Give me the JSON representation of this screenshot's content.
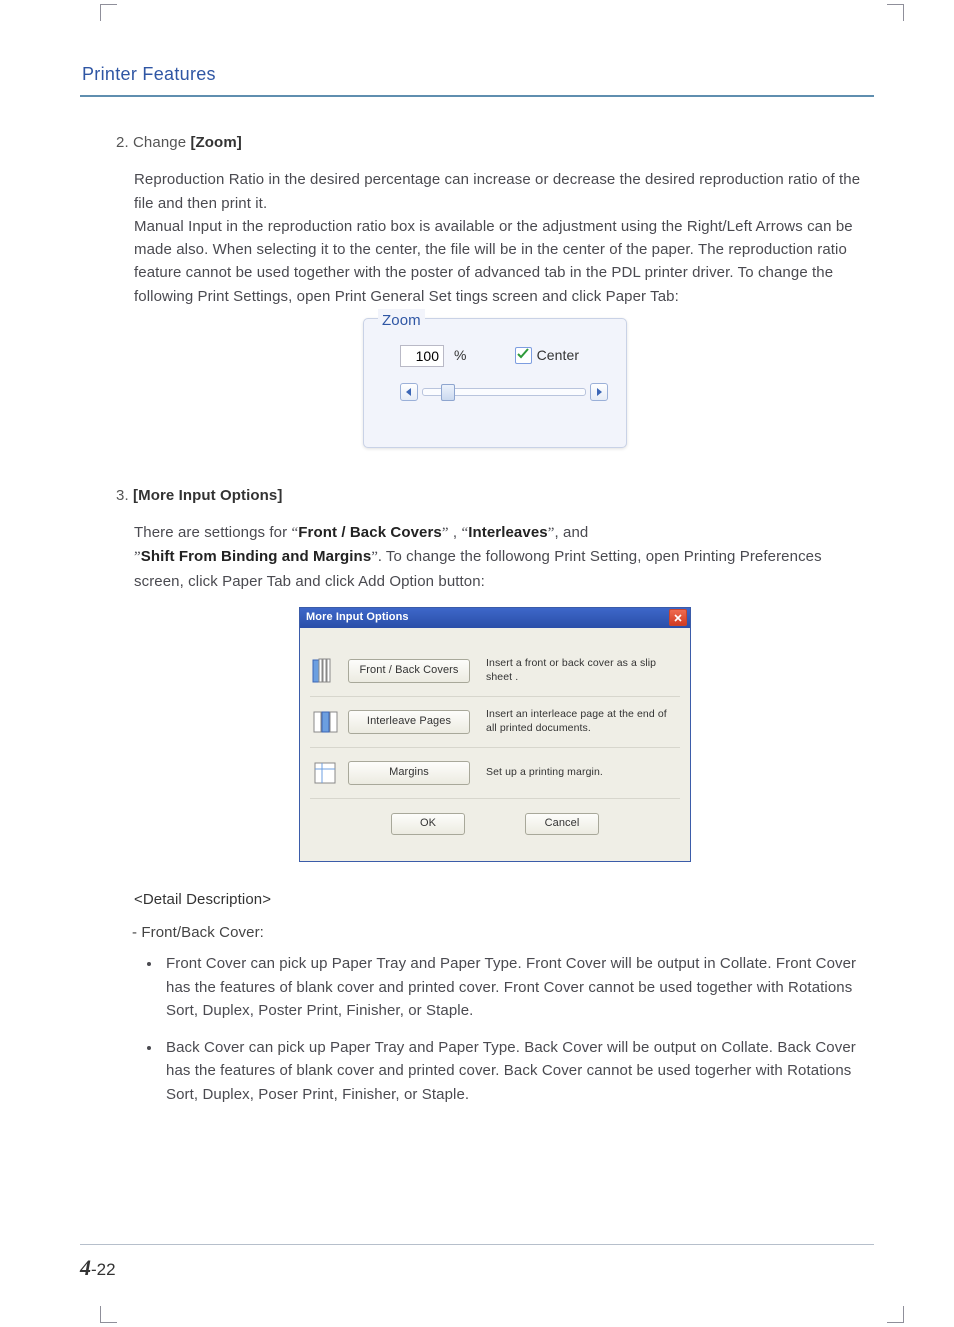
{
  "header": {
    "title": "Printer Features"
  },
  "step2": {
    "number": "2.",
    "prefix": "Change",
    "bold": "[Zoom]",
    "paragraph": "Reproduction Ratio in the desired percentage can increase or decrease the desired reproduction ratio of the file and then print it.\nManual  Input in the reproduction ratio box is available or the adjustment using the Right/Left Arrows can be made also. When selecting it to the center, the file will be in the center of the paper. The reproduction ratio feature cannot be used together with the poster of advanced tab in the PDL printer driver. To change the following Print Settings, open Print General Set tings screen and click Paper Tab:"
  },
  "zoom_widget": {
    "legend": "Zoom",
    "value": "100",
    "percent": "%",
    "checkbox_label": "Center"
  },
  "step3": {
    "number": "3.",
    "bold": "[More Input Options]",
    "line1_pre": "There are settiongs for ",
    "q1": "Front / Back Covers",
    "mid1": " , ",
    "q2": "Interleaves",
    "mid2": ", and",
    "q3": "Shift From Binding and Margins",
    "line2_tail": " To change the followong Print Setting, open Printing Preferences screen, click Paper Tab and click Add Option button:"
  },
  "mio": {
    "title": "More Input Options",
    "rows": [
      {
        "btn": "Front / Back Covers",
        "desc": "Insert a front or back cover as a slip sheet ."
      },
      {
        "btn": "Interleave Pages",
        "desc": "Insert an interleace page at the end of all printed documents."
      },
      {
        "btn": "Margins",
        "desc": "Set up a printing margin."
      }
    ],
    "ok": "OK",
    "cancel": "Cancel"
  },
  "detail": {
    "heading": "<Detail Description>",
    "lead": "- Front/Back Cover:",
    "bullets": [
      "Front Cover can pick up Paper Tray and Paper Type. Front Cover will be output in Collate. Front Cover has the features of blank cover and printed cover. Front Cover cannot be used together  with Rotations Sort, Duplex, Poster Print, Finisher, or Staple.",
      "Back Cover can pick up Paper Tray and Paper Type. Back Cover will be output on Collate. Back Cover has the features of blank cover and printed cover. Back Cover cannot be used togerher with Rotations Sort, Duplex, Poser Print, Finisher, or Staple."
    ]
  },
  "page_number": {
    "chapter": "4",
    "sep": "-",
    "page": "22"
  }
}
